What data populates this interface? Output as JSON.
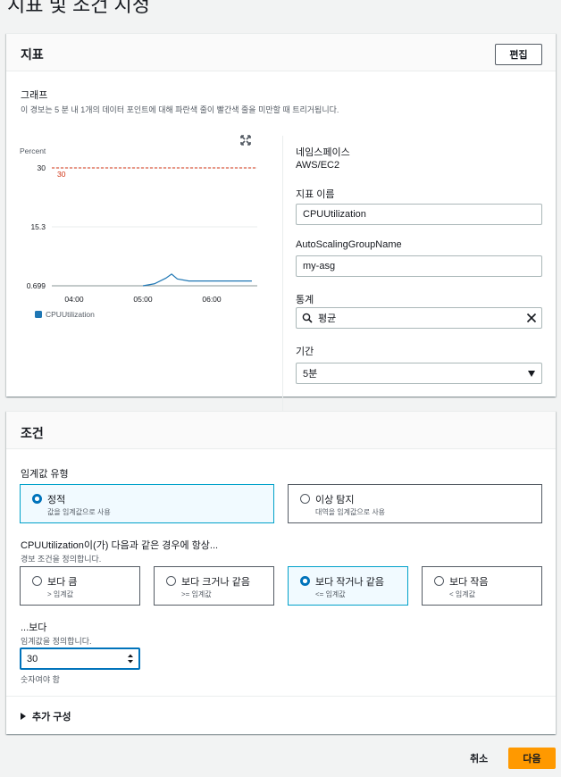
{
  "page": {
    "title": "지표 및 조건 지정"
  },
  "metric_panel": {
    "title": "지표",
    "edit_label": "편집",
    "graph_label": "그래프",
    "graph_desc": "이 경보는 5 분 내 1개의 데이터 포인트에 대해 파란색 줄이 빨간색 줄을 미만할 때 트리거됩니다.",
    "namespace_label": "네임스페이스",
    "namespace_value": "AWS/EC2",
    "metric_name_label": "지표 이름",
    "metric_name_value": "CPUUtilization",
    "asg_label": "AutoScalingGroupName",
    "asg_value": "my-asg",
    "stat_label": "통계",
    "stat_value": "평균",
    "period_label": "기간",
    "period_value": "5분",
    "legend_label": "CPUUtilization",
    "icons": {
      "expand": "expand-icon",
      "search": "search-icon",
      "clear": "clear-icon",
      "dropdown": "caret-down-icon",
      "legend": "legend-swatch"
    }
  },
  "chart_data": {
    "type": "line",
    "ylabel": "Percent",
    "yticks": [
      "30",
      "15.3",
      "0.699"
    ],
    "xticks": [
      "04:00",
      "05:00",
      "06:00"
    ],
    "ylim": [
      0.699,
      30
    ],
    "threshold": 30,
    "threshold_label": "30",
    "threshold_color": "#d13212",
    "series": [
      {
        "name": "CPUUtilization",
        "color": "#1f77b4",
        "points": [
          [
            "05:00",
            0.699
          ],
          [
            "05:10",
            1.2
          ],
          [
            "05:20",
            2.6
          ],
          [
            "05:25",
            3.6
          ],
          [
            "05:30",
            2.4
          ],
          [
            "05:40",
            1.9
          ],
          [
            "06:00",
            1.9
          ],
          [
            "06:35",
            1.9
          ]
        ]
      }
    ],
    "grid": true
  },
  "conditions_panel": {
    "title": "조건",
    "threshold_type_label": "임계값 유형",
    "threshold_types": [
      {
        "title": "정적",
        "desc": "값을 임계값으로 사용",
        "selected": true
      },
      {
        "title": "이상 탐지",
        "desc": "대역을 임계값으로 사용",
        "selected": false
      }
    ],
    "whenever_label": "CPUUtilization이(가) 다음과 같은 경우에 항상...",
    "whenever_desc": "경보 조건을 정의합니다.",
    "operators": [
      {
        "title": "보다 큼",
        "desc": "> 임계값",
        "selected": false
      },
      {
        "title": "보다 크거나 같음",
        "desc": ">= 임계값",
        "selected": false
      },
      {
        "title": "보다 작거나 같음",
        "desc": "<= 임계값",
        "selected": true
      },
      {
        "title": "보다 작음",
        "desc": "< 임계값",
        "selected": false
      }
    ],
    "than_label": "...보다",
    "than_desc": "임계값을 정의합니다.",
    "threshold_value": "30",
    "threshold_hint": "숫자여야 함",
    "additional_config_label": "추가 구성"
  },
  "footer": {
    "cancel_label": "취소",
    "next_label": "다음",
    "accent": "#ff9900"
  }
}
